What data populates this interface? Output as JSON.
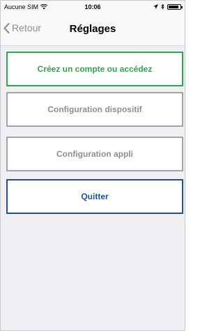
{
  "status_bar": {
    "carrier": "Aucune SIM",
    "time": "10:06",
    "battery_level": 0.8
  },
  "nav": {
    "back_label": "Retour",
    "title": "Réglages"
  },
  "buttons": {
    "create_account": "Créez un compte ou accédez",
    "device_config": "Configuration dispositif",
    "app_config": "Configuration appli",
    "quit": "Quitter"
  },
  "colors": {
    "create_account": "#2ea74a",
    "neutral": "#8e8e8e",
    "quit": "#1f4f9e"
  },
  "icons": [
    "wifi-icon",
    "location-arrow-icon",
    "bluetooth-icon",
    "battery-icon",
    "chevron-left-icon"
  ]
}
